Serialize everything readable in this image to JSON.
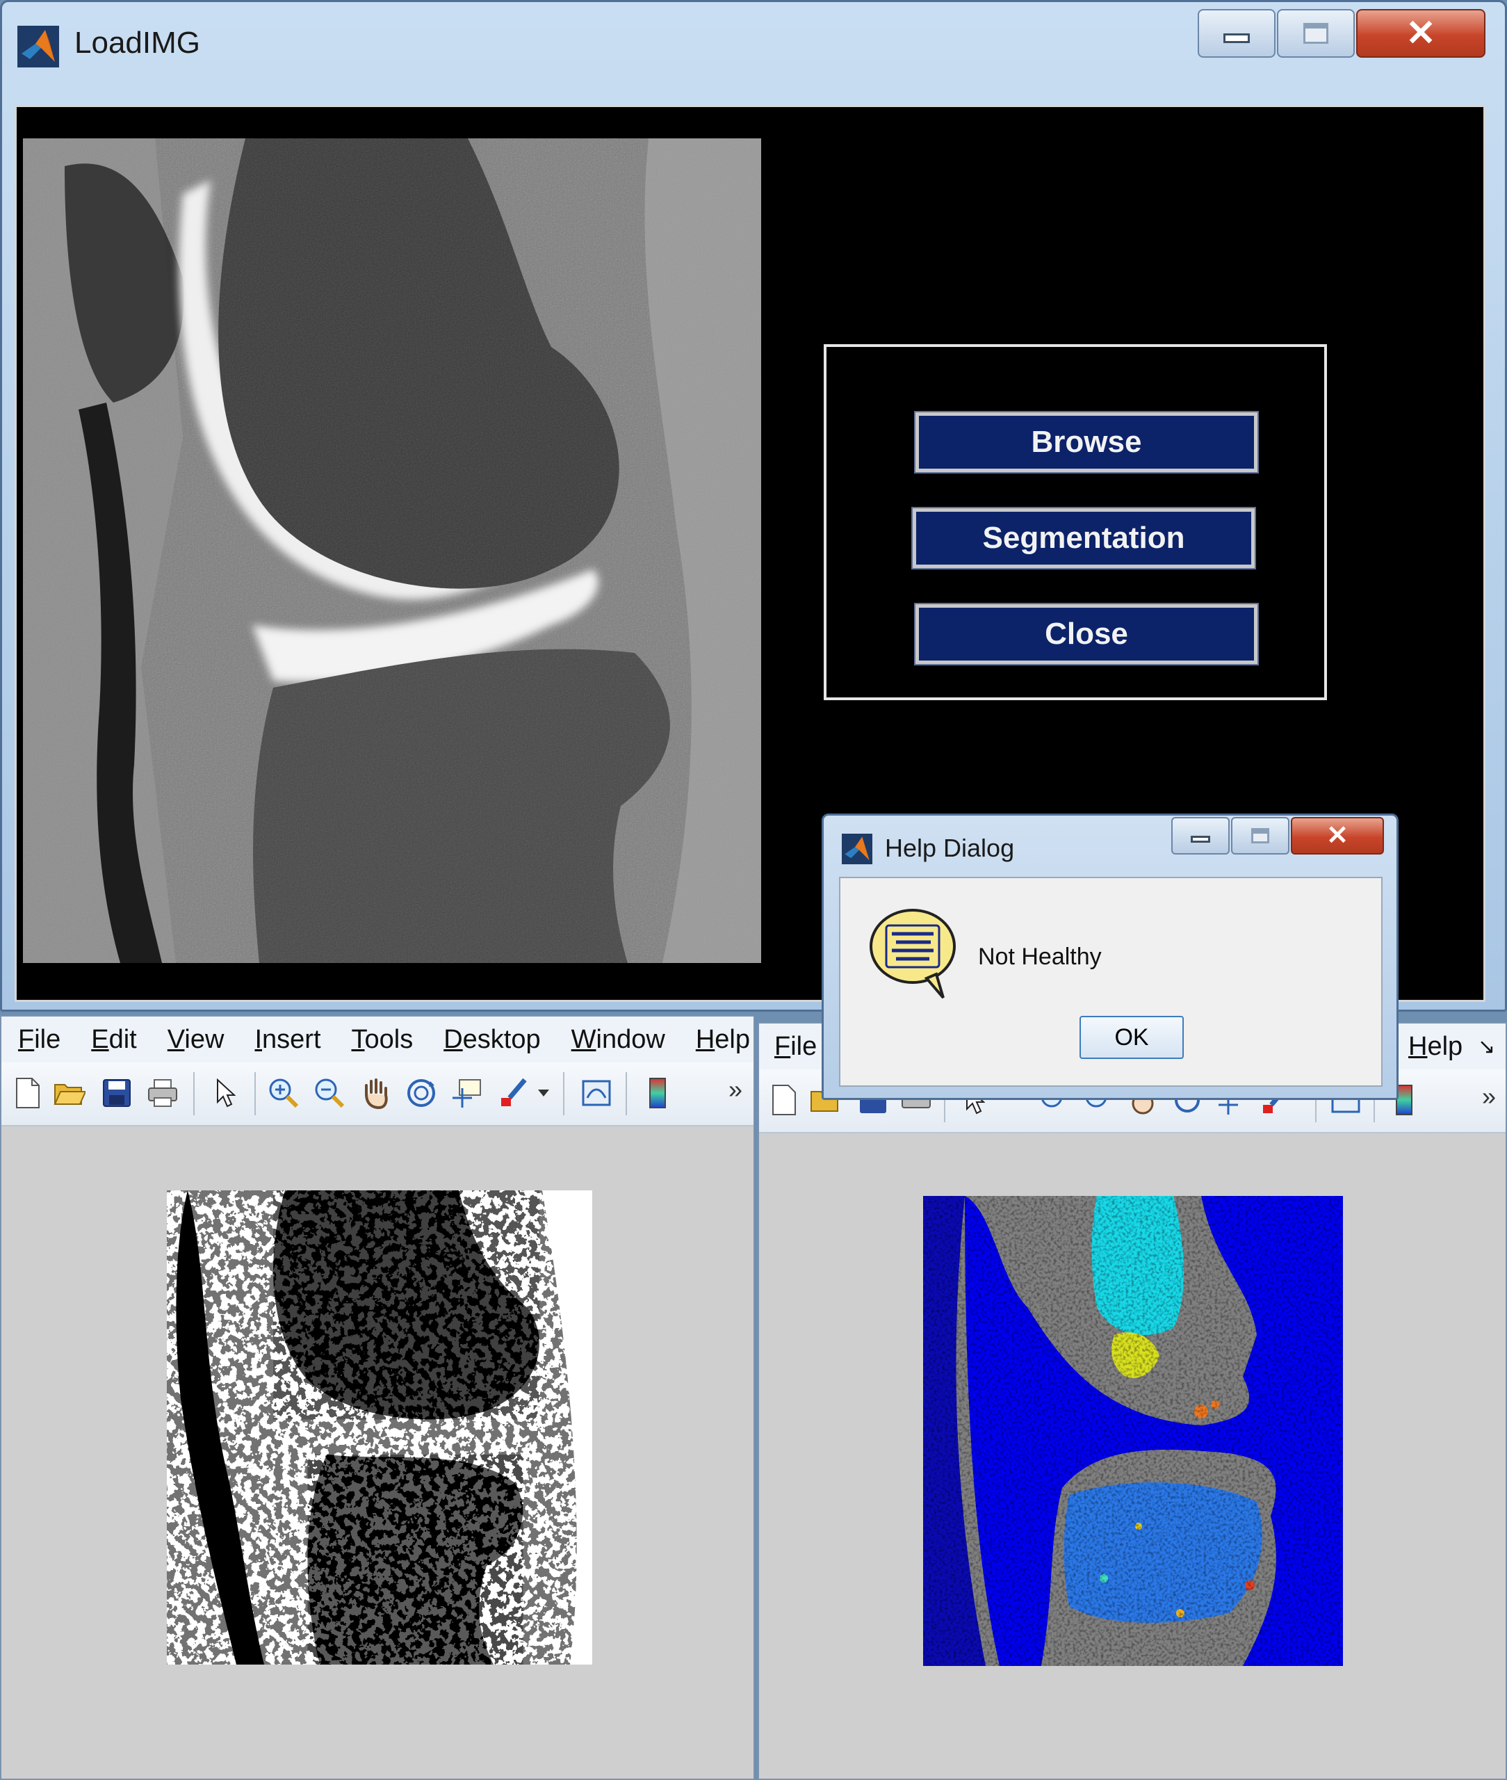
{
  "main_window": {
    "title": "LoadIMG",
    "buttons": {
      "browse": "Browse",
      "segmentation": "Segmentation",
      "close": "Close"
    }
  },
  "figure_left": {
    "menu": [
      "File",
      "Edit",
      "View",
      "Insert",
      "Tools",
      "Desktop",
      "Window",
      "Help"
    ],
    "mnemonics": [
      "F",
      "E",
      "V",
      "I",
      "T",
      "D",
      "W",
      "H"
    ]
  },
  "figure_right": {
    "menu_visible": [
      "File",
      "Help"
    ]
  },
  "help_dialog": {
    "title": "Help Dialog",
    "message": "Not Healthy",
    "ok_label": "OK"
  },
  "colors": {
    "button_fill": "#0c236a",
    "figure_background": "#cfcfcf",
    "segment_background": "#808080",
    "segment_dark_blue": "#0a0ab4",
    "segment_blue": "#0000f0",
    "segment_cyan": "#18d8e8",
    "segment_yellow": "#d8e020",
    "segment_orange": "#f07820"
  },
  "icons": [
    "new-file-icon",
    "open-folder-icon",
    "save-icon",
    "print-icon",
    "pointer-icon",
    "zoom-in-icon",
    "zoom-out-icon",
    "pan-hand-icon",
    "rotate-3d-icon",
    "data-cursor-icon",
    "brush-icon",
    "link-plot-icon",
    "colorbar-icon",
    "more-chevron-icon"
  ]
}
